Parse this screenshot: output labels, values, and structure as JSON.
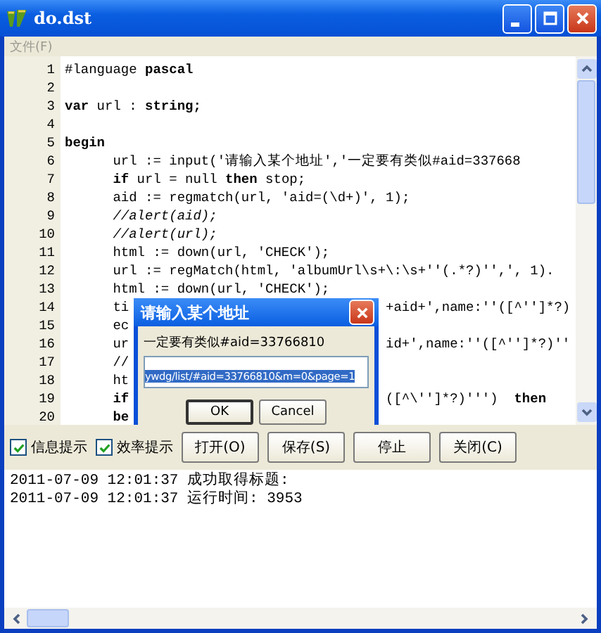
{
  "window": {
    "title": "do.dst"
  },
  "menu": [
    {
      "label": "文件(F)",
      "disabled": true
    }
  ],
  "editor": {
    "lines": [
      {
        "number": "1",
        "segments": [
          {
            "text": "#language ",
            "bold": false
          },
          {
            "text": "pascal",
            "bold": true
          }
        ]
      },
      {
        "number": "2"
      },
      {
        "number": "3",
        "segments": [
          {
            "text": "var",
            "bold": true
          },
          {
            "text": " url : ",
            "bold": false
          },
          {
            "text": "string;",
            "bold": true
          }
        ]
      },
      {
        "number": "4"
      },
      {
        "number": "5",
        "segments": [
          {
            "text": "begin",
            "bold": true
          }
        ]
      },
      {
        "number": "6",
        "segments": [
          {
            "text": "      url := input('请输入某个地址','一定要有类似#aid=337668",
            "bold": false
          }
        ]
      },
      {
        "number": "7",
        "segments": [
          {
            "text": "      if",
            "bold": true
          },
          {
            "text": " url = null ",
            "bold": false
          },
          {
            "text": "then",
            "bold": true
          },
          {
            "text": " stop;",
            "bold": false
          }
        ]
      },
      {
        "number": "8",
        "segments": [
          {
            "text": "      aid := regmatch(url, 'aid=(\\d+)', 1);",
            "bold": false
          }
        ]
      },
      {
        "number": "9",
        "comment": true,
        "segments": [
          {
            "text": "      //alert(aid);",
            "bold": false
          }
        ]
      },
      {
        "number": "10",
        "comment": true,
        "segments": [
          {
            "text": "      //alert(url);",
            "bold": false
          }
        ]
      },
      {
        "number": "11",
        "segments": [
          {
            "text": "      html := down(url, 'CHECK');",
            "bold": false
          }
        ]
      },
      {
        "number": "12",
        "segments": [
          {
            "text": "      url := regMatch(html, 'albumUrl\\s+\\:\\s+''(.*?)'',', 1).",
            "bold": false
          }
        ]
      },
      {
        "number": "13",
        "segments": [
          {
            "text": "      html := down(url, 'CHECK');",
            "bold": false
          }
        ]
      },
      {
        "number": "14",
        "segments": [
          {
            "text": "      ti",
            "bold": false
          }
        ],
        "right": [
          {
            "text": "+aid+',name:''([^'']*?)",
            "bold": false
          }
        ]
      },
      {
        "number": "15",
        "segments": [
          {
            "text": "      ec",
            "bold": false
          }
        ]
      },
      {
        "number": "16",
        "segments": [
          {
            "text": "      ur",
            "bold": false
          }
        ],
        "right": [
          {
            "text": "id+',name:''([^'']*?)''",
            "bold": false
          }
        ]
      },
      {
        "number": "17",
        "segments": [
          {
            "text": "      //",
            "bold": false
          }
        ]
      },
      {
        "number": "18",
        "segments": [
          {
            "text": "      ht",
            "bold": false
          }
        ]
      },
      {
        "number": "19",
        "segments": [
          {
            "text": "      if",
            "bold": true
          }
        ],
        "right": [
          {
            "text": "([^\\'']*?)''')  ",
            "bold": false
          },
          {
            "text": "then",
            "bold": true
          }
        ]
      },
      {
        "number": "20",
        "segments": [
          {
            "text": "      be",
            "bold": true
          }
        ]
      }
    ]
  },
  "dialog": {
    "title": "请输入某个地址",
    "prompt": "一定要有类似#aid=33766810",
    "value": "ywdg/list/#aid=33766810&m=0&page=1",
    "value_selected": true,
    "buttons": [
      {
        "label": "OK",
        "default": true
      },
      {
        "label": "Cancel",
        "default": false
      }
    ]
  },
  "toolbar": {
    "checkboxes": [
      {
        "label": "信息提示",
        "checked": true
      },
      {
        "label": "效率提示",
        "checked": true
      }
    ],
    "buttons": [
      {
        "label": "打开(O)"
      },
      {
        "label": "保存(S)"
      },
      {
        "label": "停止"
      },
      {
        "label": "关闭(C)"
      }
    ]
  },
  "log": [
    "2011-07-09 12:01:37 成功取得标题:",
    "2011-07-09 12:01:37 运行时间: 3953"
  ]
}
